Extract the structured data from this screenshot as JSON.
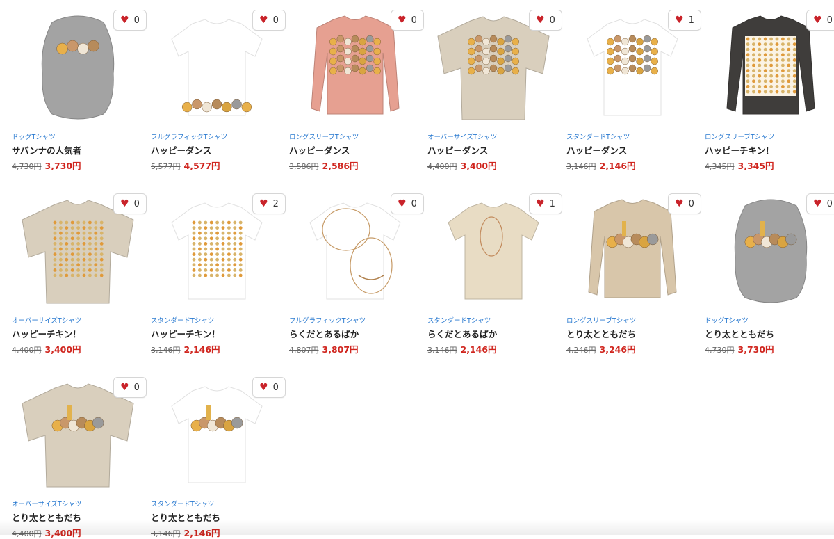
{
  "products": [
    {
      "category": "ドッグTシャツ",
      "title": "サバンナの人気者",
      "old_price": "4,730円",
      "price": "3,730円",
      "favorites": "0",
      "garment": "dog",
      "color": "#a3a3a3",
      "print": "animals-small"
    },
    {
      "category": "フルグラフィックTシャツ",
      "title": "ハッピーダンス",
      "old_price": "5,577円",
      "price": "4,577円",
      "favorites": "0",
      "garment": "tee",
      "color": "#ffffff",
      "print": "bottom-border"
    },
    {
      "category": "ロングスリーブTシャツ",
      "title": "ハッピーダンス",
      "old_price": "3,586円",
      "price": "2,586円",
      "favorites": "0",
      "garment": "longsleeve",
      "color": "#e6a091",
      "print": "dance-rows"
    },
    {
      "category": "オーバーサイズTシャツ",
      "title": "ハッピーダンス",
      "old_price": "4,400円",
      "price": "3,400円",
      "favorites": "0",
      "garment": "oversize",
      "color": "#d9cfbd",
      "print": "dance-rows"
    },
    {
      "category": "スタンダードTシャツ",
      "title": "ハッピーダンス",
      "old_price": "3,146円",
      "price": "2,146円",
      "favorites": "1",
      "garment": "tee",
      "color": "#ffffff",
      "print": "dance-rows"
    },
    {
      "category": "ロングスリーブTシャツ",
      "title": "ハッピーチキン！",
      "old_price": "4,345円",
      "price": "3,345円",
      "favorites": "0",
      "garment": "longsleeve",
      "color": "#3f3d3b",
      "print": "pattern-light"
    },
    {
      "category": "オーバーサイズTシャツ",
      "title": "ハッピーチキン！",
      "old_price": "4,400円",
      "price": "3,400円",
      "favorites": "0",
      "garment": "oversize",
      "color": "#d9cfbd",
      "print": "pattern"
    },
    {
      "category": "スタンダードTシャツ",
      "title": "ハッピーチキン！",
      "old_price": "3,146円",
      "price": "2,146円",
      "favorites": "2",
      "garment": "tee",
      "color": "#ffffff",
      "print": "pattern"
    },
    {
      "category": "フルグラフィックTシャツ",
      "title": "らくだとあるぱか",
      "old_price": "4,807円",
      "price": "3,807円",
      "favorites": "0",
      "garment": "tee",
      "color": "#ffffff",
      "print": "sketch-full"
    },
    {
      "category": "スタンダードTシャツ",
      "title": "らくだとあるぱか",
      "old_price": "3,146円",
      "price": "2,146円",
      "favorites": "1",
      "garment": "tee",
      "color": "#e8dcc4",
      "print": "sketch-small"
    },
    {
      "category": "ロングスリーブTシャツ",
      "title": "とり太とともだち",
      "old_price": "4,246円",
      "price": "3,246円",
      "favorites": "0",
      "garment": "longsleeve",
      "color": "#d8c6aa",
      "print": "group"
    },
    {
      "category": "ドッグTシャツ",
      "title": "とり太とともだち",
      "old_price": "4,730円",
      "price": "3,730円",
      "favorites": "0",
      "garment": "dog",
      "color": "#a3a3a3",
      "print": "group"
    },
    {
      "category": "オーバーサイズTシャツ",
      "title": "とり太とともだち",
      "old_price": "4,400円",
      "price": "3,400円",
      "favorites": "0",
      "garment": "oversize",
      "color": "#d9cfbd",
      "print": "group"
    },
    {
      "category": "スタンダードTシャツ",
      "title": "とり太とともだち",
      "old_price": "3,146円",
      "price": "2,146円",
      "favorites": "0",
      "garment": "tee",
      "color": "#ffffff",
      "print": "group"
    }
  ],
  "icons": {
    "favorite": "heart-icon"
  },
  "colors": {
    "category_link": "#2a7ad0",
    "sale_price": "#d0261f",
    "favorite_heart": "#c9232a"
  }
}
